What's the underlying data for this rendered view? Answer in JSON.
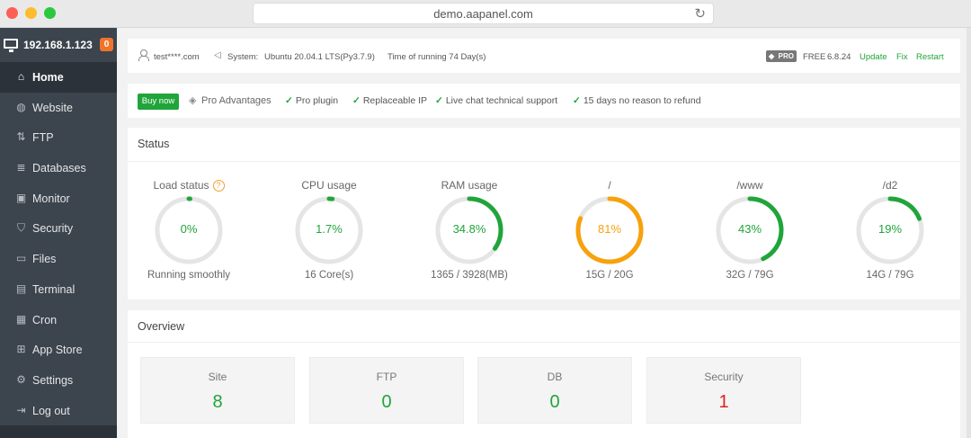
{
  "browser": {
    "url": "demo.aapanel.com"
  },
  "sidebar": {
    "server_ip": "192.168.1.123",
    "notifications": "0",
    "items": [
      {
        "label": "Home",
        "icon": "home-icon"
      },
      {
        "label": "Website",
        "icon": "globe-icon"
      },
      {
        "label": "FTP",
        "icon": "ftp-icon"
      },
      {
        "label": "Databases",
        "icon": "database-icon"
      },
      {
        "label": "Monitor",
        "icon": "monitor-icon"
      },
      {
        "label": "Security",
        "icon": "shield-icon"
      },
      {
        "label": "Files",
        "icon": "folder-icon"
      },
      {
        "label": "Terminal",
        "icon": "terminal-icon"
      },
      {
        "label": "Cron",
        "icon": "calendar-icon"
      },
      {
        "label": "App Store",
        "icon": "grid-icon"
      },
      {
        "label": "Settings",
        "icon": "gear-icon"
      },
      {
        "label": "Log out",
        "icon": "logout-icon"
      }
    ]
  },
  "topinfo": {
    "user": "test****.com",
    "system_label": "System:",
    "system_value": "Ubuntu 20.04.1 LTS(Py3.7.9)",
    "runtime": "Time of running 74 Day(s)",
    "pro_badge": "PRO",
    "edition": "FREE",
    "version": "6.8.24",
    "update": "Update",
    "fix": "Fix",
    "restart": "Restart"
  },
  "probar": {
    "buy_now": "Buy now",
    "pro_advantages": "Pro Advantages",
    "features": [
      "Pro plugin",
      "Replaceable IP",
      "Live chat technical support",
      "15 days no reason to refund"
    ]
  },
  "status": {
    "title": "Status",
    "gauges": [
      {
        "title": "Load status",
        "value": "0%",
        "percent": 0,
        "sub": "Running smoothly",
        "color": "#20a53a"
      },
      {
        "title": "CPU usage",
        "value": "1.7%",
        "percent": 1.7,
        "sub": "16 Core(s)",
        "color": "#20a53a"
      },
      {
        "title": "RAM usage",
        "value": "34.8%",
        "percent": 34.8,
        "sub": "1365 / 3928(MB)",
        "color": "#20a53a"
      },
      {
        "title": "/",
        "value": "81%",
        "percent": 81,
        "sub": "15G / 20G",
        "color": "#f7a10c"
      },
      {
        "title": "/www",
        "value": "43%",
        "percent": 43,
        "sub": "32G / 79G",
        "color": "#20a53a"
      },
      {
        "title": "/d2",
        "value": "19%",
        "percent": 19,
        "sub": "14G / 79G",
        "color": "#20a53a"
      }
    ]
  },
  "overview": {
    "title": "Overview",
    "cards": [
      {
        "label": "Site",
        "value": "8",
        "color": "#20a53a"
      },
      {
        "label": "FTP",
        "value": "0",
        "color": "#20a53a"
      },
      {
        "label": "DB",
        "value": "0",
        "color": "#20a53a"
      },
      {
        "label": "Security",
        "value": "1",
        "color": "#e02020"
      }
    ]
  },
  "colors": {
    "accent": "#20a53a",
    "warning": "#f7a10c",
    "danger": "#e02020",
    "sidebar": "#3c444d"
  }
}
